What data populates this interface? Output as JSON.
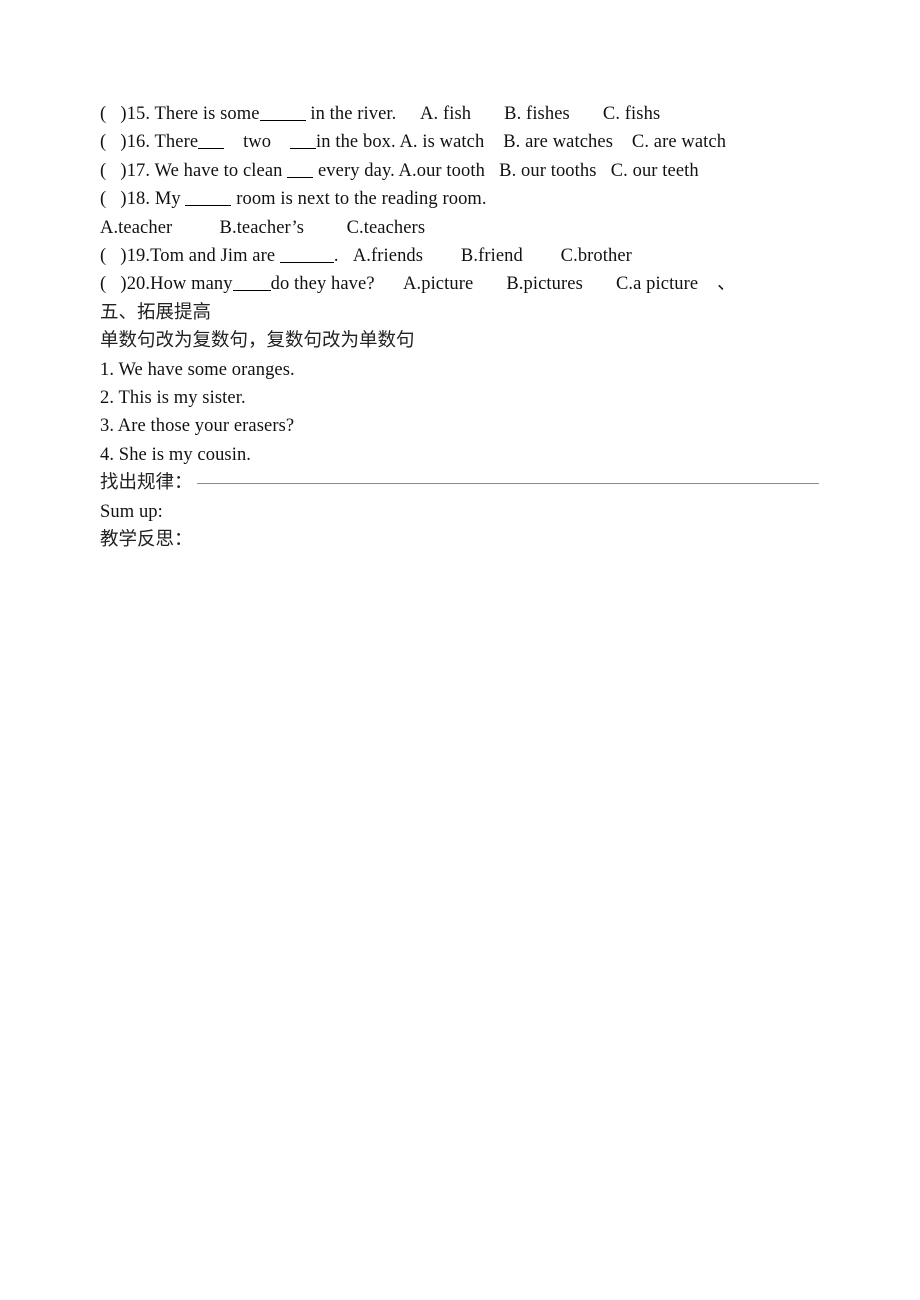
{
  "document": {
    "type": "worksheet-page",
    "language": "en-zh",
    "background_color": "#ffffff",
    "text_color": "#000000"
  },
  "multiple_choice": {
    "items": [
      {
        "marker": "(    )15.",
        "stem_before": " There is some ",
        "blank": "b-md",
        "stem_after": " in the river.",
        "options": [
          "A. fish",
          "B. fishes",
          "C. fishs"
        ]
      },
      {
        "marker": "(    )16.",
        "stem_before": " There",
        "blank": "b-xs",
        "stem_mid": "    two    ",
        "blank2": "b-xs",
        "stem_after": "in the box.",
        "options": [
          "A. is watch",
          "B. are watches",
          "C. are watch"
        ]
      },
      {
        "marker": "(    )17.",
        "stem_before": " We have to clean ",
        "blank": "b-xs",
        "stem_after": " every day.",
        "options": [
          "A.our tooth",
          "B. our tooths",
          "C. our teeth"
        ]
      },
      {
        "marker": "(    )18.",
        "stem_before": " My ",
        "blank": "b-md",
        "stem_after": " room is next to the reading room.",
        "options": [
          "A.teacher",
          "B.teacher’s",
          "C.teachers"
        ]
      },
      {
        "marker": "(    )19.",
        "stem_before": "Tom and Jim are ",
        "blank": "b-lg",
        "stem_after": ".",
        "options": [
          "A.friends",
          "B.friend",
          "C.brother"
        ]
      },
      {
        "marker": "(    )20.",
        "stem_before": "How many",
        "blank": "b-sm",
        "stem_after": "do they have?",
        "options": [
          "A.picture",
          "B.pictures",
          "C.a picture"
        ],
        "trailing_mark": "、"
      }
    ]
  },
  "section_five": {
    "heading": "五、拓展提高",
    "instruction": "单数句改为复数句，复数句改为单数句",
    "sentences": [
      "1. We have some oranges.",
      "2. This is my sister.",
      "3. Are those your erasers?",
      "4. She is my cousin."
    ]
  },
  "footer": {
    "find_rule_label": "找出规律：",
    "sum_up_label": "Sum up:",
    "reflection_label": "教学反思："
  },
  "line_texts": {
    "q15": "(   )15. There is some",
    "q15_tail": "in the river.",
    "q15_a": "A. fish",
    "q15_b": "B. fishes",
    "q15_c": "C. fishs",
    "q16": "(   )16. There",
    "q16_mid": "two",
    "q16_tail": "in the box. A. is watch",
    "q16_b": "B. are watches",
    "q16_c": "C. are watch",
    "q17": "(   )17. We have to clean",
    "q17_tail": "every day. A.our tooth",
    "q17_b": "B. our tooths",
    "q17_c": "C. our teeth",
    "q18": "(   )18. My",
    "q18_tail": "room is next to the reading room.",
    "q18_a": "A.teacher",
    "q18_b": "B.teacher’s",
    "q18_c": "C.teachers",
    "q19": "(   )19.Tom and Jim are",
    "q19_tail": ".",
    "q19_a": "A.friends",
    "q19_b": "B.friend",
    "q19_c": "C.brother",
    "q20": "(   )20.How many",
    "q20_tail": "do they have?",
    "q20_a": "A.picture",
    "q20_b": "B.pictures",
    "q20_c": "C.a picture",
    "q20_mark": "、"
  }
}
